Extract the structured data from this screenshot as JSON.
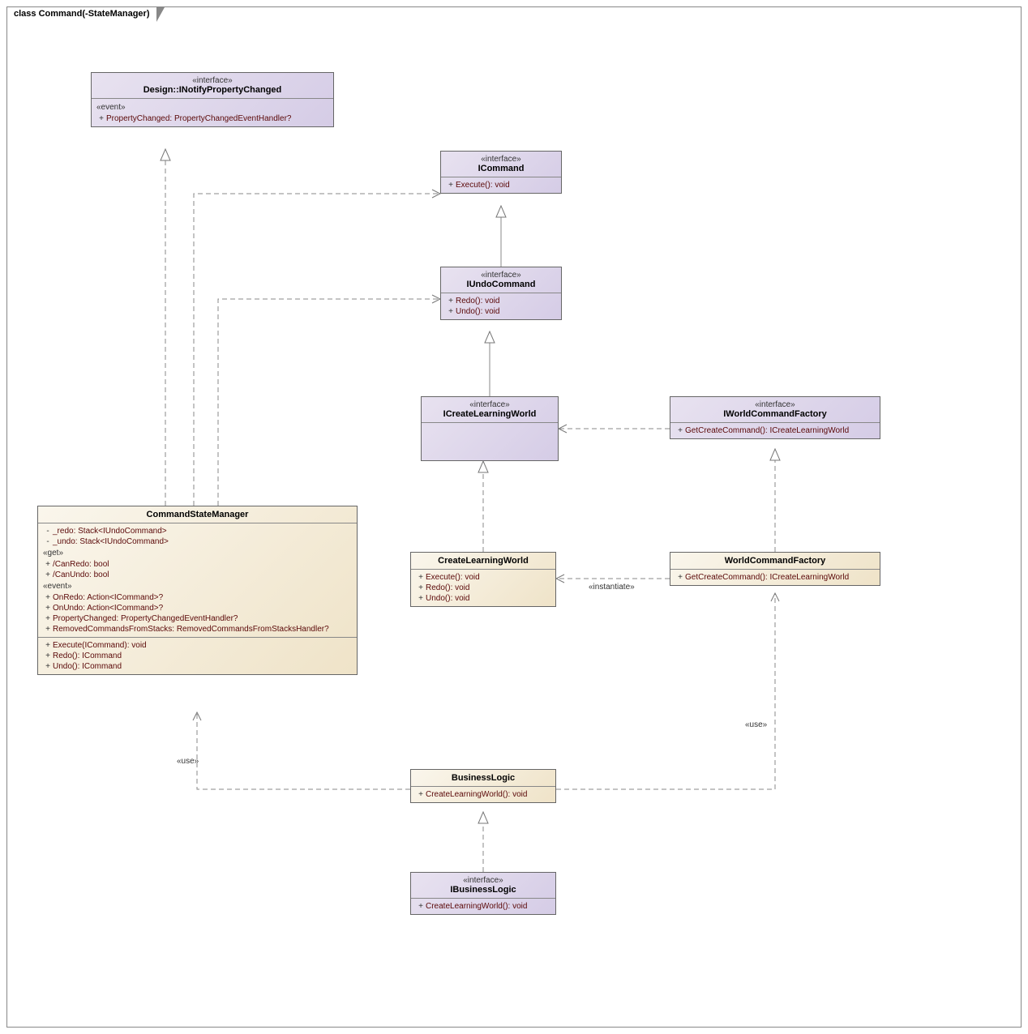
{
  "title": "class Command(-StateManager)",
  "boxes": {
    "inpc": {
      "stereotype": "«interface»",
      "name": "Design::INotifyPropertyChanged",
      "sections": [
        {
          "label": "«event»",
          "members": [
            {
              "vis": "+",
              "text": "PropertyChanged: PropertyChangedEventHandler?"
            }
          ]
        }
      ]
    },
    "icommand": {
      "stereotype": "«interface»",
      "name": "ICommand",
      "sections": [
        {
          "members": [
            {
              "vis": "+",
              "text": "Execute(): void"
            }
          ]
        }
      ]
    },
    "iundo": {
      "stereotype": "«interface»",
      "name": "IUndoCommand",
      "sections": [
        {
          "members": [
            {
              "vis": "+",
              "text": "Redo(): void"
            },
            {
              "vis": "+",
              "text": "Undo(): void"
            }
          ]
        }
      ]
    },
    "iclw": {
      "stereotype": "«interface»",
      "name": "ICreateLearningWorld",
      "sections": []
    },
    "iwcf": {
      "stereotype": "«interface»",
      "name": "IWorldCommandFactory",
      "sections": [
        {
          "members": [
            {
              "vis": "+",
              "text": "GetCreateCommand(): ICreateLearningWorld"
            }
          ]
        }
      ]
    },
    "csm": {
      "name": "CommandStateManager",
      "sections": [
        {
          "members": [
            {
              "vis": "-",
              "text": "_redo: Stack<IUndoCommand>"
            },
            {
              "vis": "-",
              "text": "_undo: Stack<IUndoCommand>"
            }
          ]
        },
        {
          "label": "«get»",
          "members": [
            {
              "vis": "+",
              "text": "/CanRedo: bool"
            },
            {
              "vis": "+",
              "text": "/CanUndo: bool"
            }
          ]
        },
        {
          "label": "«event»",
          "members": [
            {
              "vis": "+",
              "text": "OnRedo: Action<ICommand>?"
            },
            {
              "vis": "+",
              "text": "OnUndo: Action<ICommand>?"
            },
            {
              "vis": "+",
              "text": "PropertyChanged: PropertyChangedEventHandler?"
            },
            {
              "vis": "+",
              "text": "RemovedCommandsFromStacks: RemovedCommandsFromStacksHandler?"
            }
          ]
        },
        {
          "members": [
            {
              "vis": "+",
              "text": "Execute(ICommand): void"
            },
            {
              "vis": "+",
              "text": "Redo(): ICommand"
            },
            {
              "vis": "+",
              "text": "Undo(): ICommand"
            }
          ]
        }
      ]
    },
    "clw": {
      "name": "CreateLearningWorld",
      "sections": [
        {
          "members": [
            {
              "vis": "+",
              "text": "Execute(): void"
            },
            {
              "vis": "+",
              "text": "Redo(): void"
            },
            {
              "vis": "+",
              "text": "Undo(): void"
            }
          ]
        }
      ]
    },
    "wcf": {
      "name": "WorldCommandFactory",
      "sections": [
        {
          "members": [
            {
              "vis": "+",
              "text": "GetCreateCommand(): ICreateLearningWorld"
            }
          ]
        }
      ]
    },
    "bl": {
      "name": "BusinessLogic",
      "sections": [
        {
          "members": [
            {
              "vis": "+",
              "text": "CreateLearningWorld(): void"
            }
          ]
        }
      ]
    },
    "ibl": {
      "stereotype": "«interface»",
      "name": "IBusinessLogic",
      "sections": [
        {
          "members": [
            {
              "vis": "+",
              "text": "CreateLearningWorld(): void"
            }
          ]
        }
      ]
    }
  },
  "labels": {
    "use1": "«use»",
    "use2": "«use»",
    "instantiate": "«instantiate»"
  }
}
